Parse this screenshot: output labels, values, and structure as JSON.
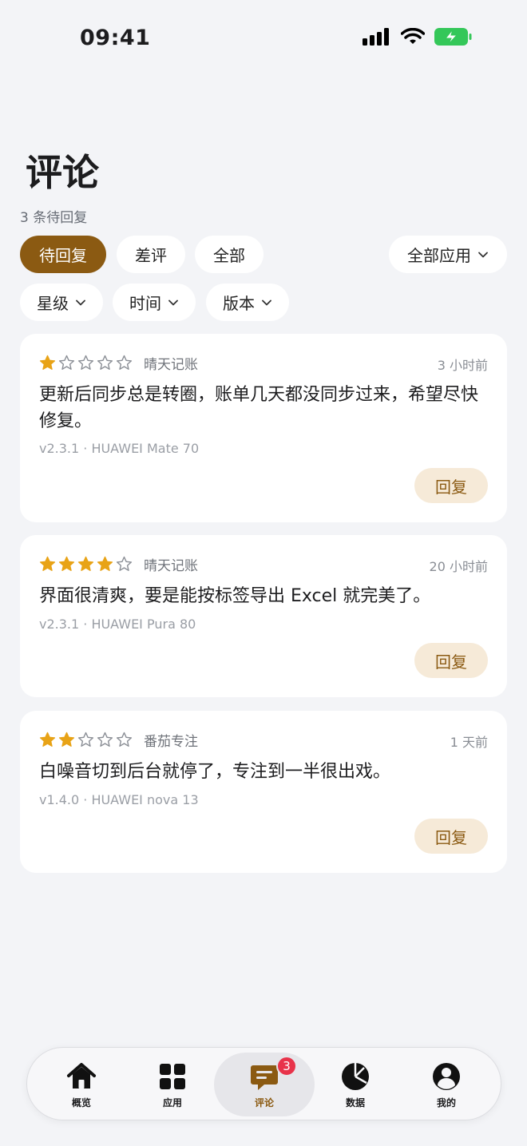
{
  "status": {
    "time": "09:41"
  },
  "header": {
    "title": "评论",
    "pending": "3 条待回复"
  },
  "filters": {
    "tabs": [
      {
        "label": "待回复",
        "active": true
      },
      {
        "label": "差评",
        "active": false
      },
      {
        "label": "全部",
        "active": false
      }
    ],
    "app_select": "全部应用",
    "dropdowns": [
      "星级",
      "时间",
      "版本"
    ]
  },
  "reviews": [
    {
      "stars": 1,
      "app": "晴天记账",
      "time": "3 小时前",
      "text": "更新后同步总是转圈，账单几天都没同步过来，希望尽快修复。",
      "meta": "v2.3.1 · HUAWEI Mate 70",
      "reply": "回复"
    },
    {
      "stars": 4,
      "app": "晴天记账",
      "time": "20 小时前",
      "text": "界面很清爽，要是能按标签导出 Excel 就完美了。",
      "meta": "v2.3.1 · HUAWEI Pura 80",
      "reply": "回复"
    },
    {
      "stars": 2,
      "app": "番茄专注",
      "time": "1 天前",
      "text": "白噪音切到后台就停了，专注到一半很出戏。",
      "meta": "v1.4.0 · HUAWEI nova 13",
      "reply": "回复"
    }
  ],
  "tabbar": {
    "items": [
      {
        "label": "概览",
        "icon": "home-icon"
      },
      {
        "label": "应用",
        "icon": "grid-icon"
      },
      {
        "label": "评论",
        "icon": "comment-icon",
        "badge": "3",
        "active": true
      },
      {
        "label": "数据",
        "icon": "pie-chart-icon"
      },
      {
        "label": "我的",
        "icon": "user-icon"
      }
    ]
  },
  "colors": {
    "accent": "#8b5a12",
    "star": "#e8a317",
    "badge": "#e8334a",
    "battery": "#34c759"
  }
}
